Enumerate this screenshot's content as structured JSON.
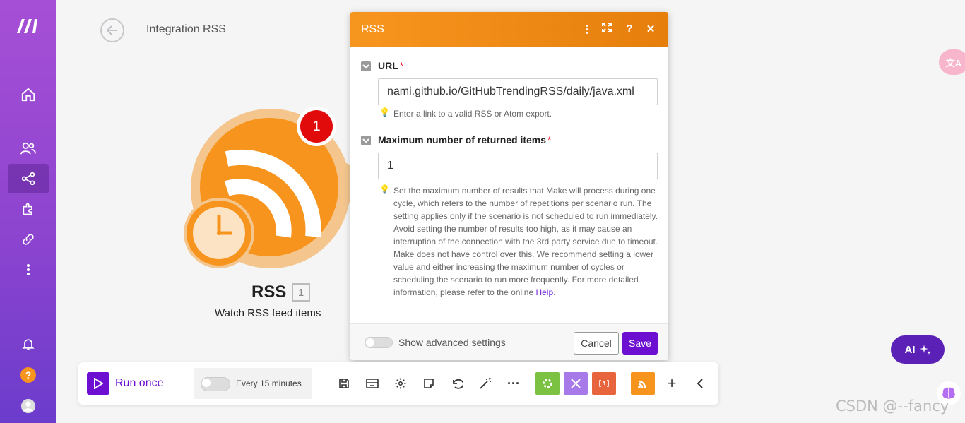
{
  "sidebar": {
    "items": [
      {
        "name": "home-icon"
      },
      {
        "name": "team-icon"
      },
      {
        "name": "scenarios-icon"
      },
      {
        "name": "apps-icon"
      },
      {
        "name": "connections-icon"
      },
      {
        "name": "more-icon"
      },
      {
        "name": "notifications-icon"
      },
      {
        "name": "help-icon"
      },
      {
        "name": "profile-icon"
      }
    ]
  },
  "header": {
    "title": "Integration RSS"
  },
  "module": {
    "name": "RSS",
    "count": "1",
    "description": "Watch RSS feed items",
    "badge": "1",
    "color": "#f7941d"
  },
  "dialog": {
    "title": "RSS",
    "url_label": "URL",
    "required_mark": "*",
    "url_value": "nami.github.io/GitHubTrendingRSS/daily/java.xml",
    "url_hint": "Enter a link to a valid RSS or Atom export.",
    "max_label": "Maximum number of returned items",
    "max_value": "1",
    "max_hint": "Set the maximum number of results that Make will process during one cycle, which refers to the number of repetitions per scenario run. The setting applies only if the scenario is not scheduled to run immediately. Avoid setting the number of results too high, as it may cause an interruption of the connection with the 3rd party service due to timeout. Make does not have control over this. We recommend setting a lower value and either increasing the maximum number of cycles or scheduling the scenario to run more frequently. For more detailed information, please refer to the online",
    "help_link": "Help",
    "show_advanced": "Show advanced settings",
    "cancel": "Cancel",
    "save": "Save"
  },
  "toolbar": {
    "run_once": "Run once",
    "schedule": "Every 15 minutes",
    "accent": "#6d0fd1"
  },
  "ai_button": "AI",
  "watermark": "CSDN @--fancy"
}
